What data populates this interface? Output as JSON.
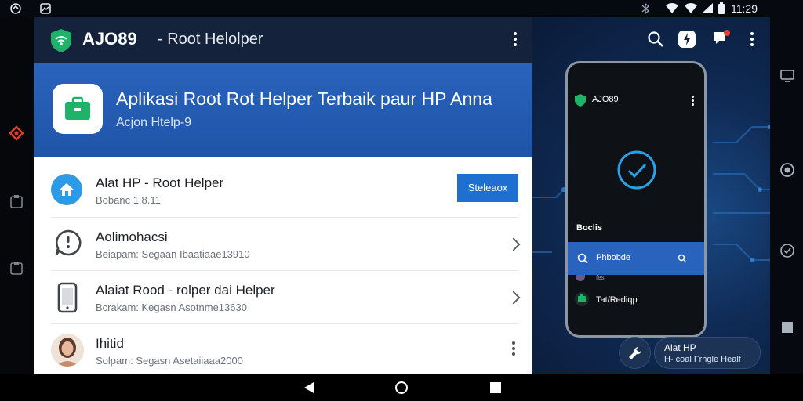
{
  "status_bar": {
    "time": "11:29"
  },
  "app_bar": {
    "title_brand": "AJO89",
    "title_rest": "- Root Helolper"
  },
  "hero": {
    "title": "Aplikasi Root Rot Helper Terbaik paur HP Anna",
    "subtitle": "Acjon Htelp-9"
  },
  "list": {
    "items": [
      {
        "title": "Alat HP - Root Helper",
        "subtitle": "Bobanc 1.8.11",
        "action": "Steleaox"
      },
      {
        "title": "Aolimohacsi",
        "subtitle": "Beiapam: Segaan Ibaatiaae13910"
      },
      {
        "title": "Alaiat Rood - rolper dai Helper",
        "subtitle": "Bcrakam: Kegasn Asotnme13630"
      },
      {
        "title": "Ihitid",
        "subtitle": "Solpam: Segasn Asetaiiaaa2000"
      }
    ]
  },
  "phone": {
    "app_title": "AJO89",
    "section_label": "Boclis",
    "search_label": "Phbobde",
    "faded_item": "fes",
    "list_item": "Tat/Rediqp"
  },
  "toast": {
    "line1": "Alat HP",
    "line2": "H- coal Frhgle Healf"
  },
  "colors": {
    "accent": "#1f6fd1",
    "hero_bg": "#2a63bd",
    "check_ring": "#2aa0e8"
  }
}
